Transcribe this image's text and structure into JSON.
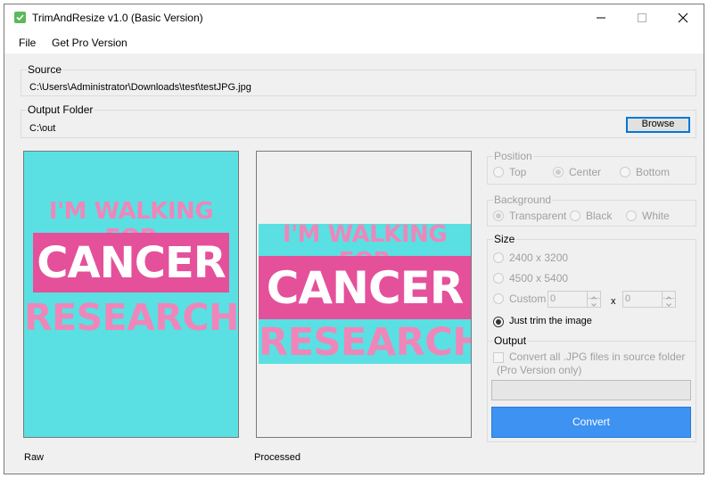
{
  "window": {
    "title": "TrimAndResize v1.0 (Basic Version)",
    "icon": "checkbox-check-icon",
    "controls": {
      "minimize_icon": "minimize-icon",
      "maximize_icon": "maximize-icon",
      "close_icon": "close-icon"
    }
  },
  "menu": {
    "items": [
      "File",
      "Get Pro Version"
    ]
  },
  "source": {
    "label": "Source",
    "path": "C:\\Users\\Administrator\\Downloads\\test\\testJPG.jpg"
  },
  "output_folder": {
    "label": "Output Folder",
    "path": "C:\\out",
    "browse_label": "Browse"
  },
  "previews": {
    "raw_label": "Raw",
    "processed_label": "Processed",
    "image_text": {
      "line1": "I'M WALKING FOR",
      "line2": "CANCER",
      "line3": "RESEARCH"
    },
    "colors": {
      "background": "#5ae0e2",
      "pink_light": "#ef86ba",
      "pink_dark": "#e5509b"
    }
  },
  "position": {
    "label": "Position",
    "options": [
      "Top",
      "Center",
      "Bottom"
    ],
    "selected": "Center",
    "enabled": false
  },
  "background": {
    "label": "Background",
    "options": [
      "Transparent",
      "Black",
      "White"
    ],
    "selected": "Transparent",
    "enabled": false
  },
  "size": {
    "label": "Size",
    "options": [
      "2400 x 3200",
      "4500 x 5400",
      "Custom",
      "Just trim the image"
    ],
    "selected": "Just trim the image",
    "custom_width": "0",
    "custom_height": "0",
    "custom_separator": "x"
  },
  "output": {
    "label": "Output",
    "convert_all_label_line1": "Convert all .JPG files in source folder",
    "convert_all_label_line2": "(Pro Version only)",
    "convert_all_checked": false,
    "progress": 0,
    "convert_label": "Convert"
  },
  "colors": {
    "accent": "#3d92f2",
    "disabled_text": "#a0a0a0"
  }
}
